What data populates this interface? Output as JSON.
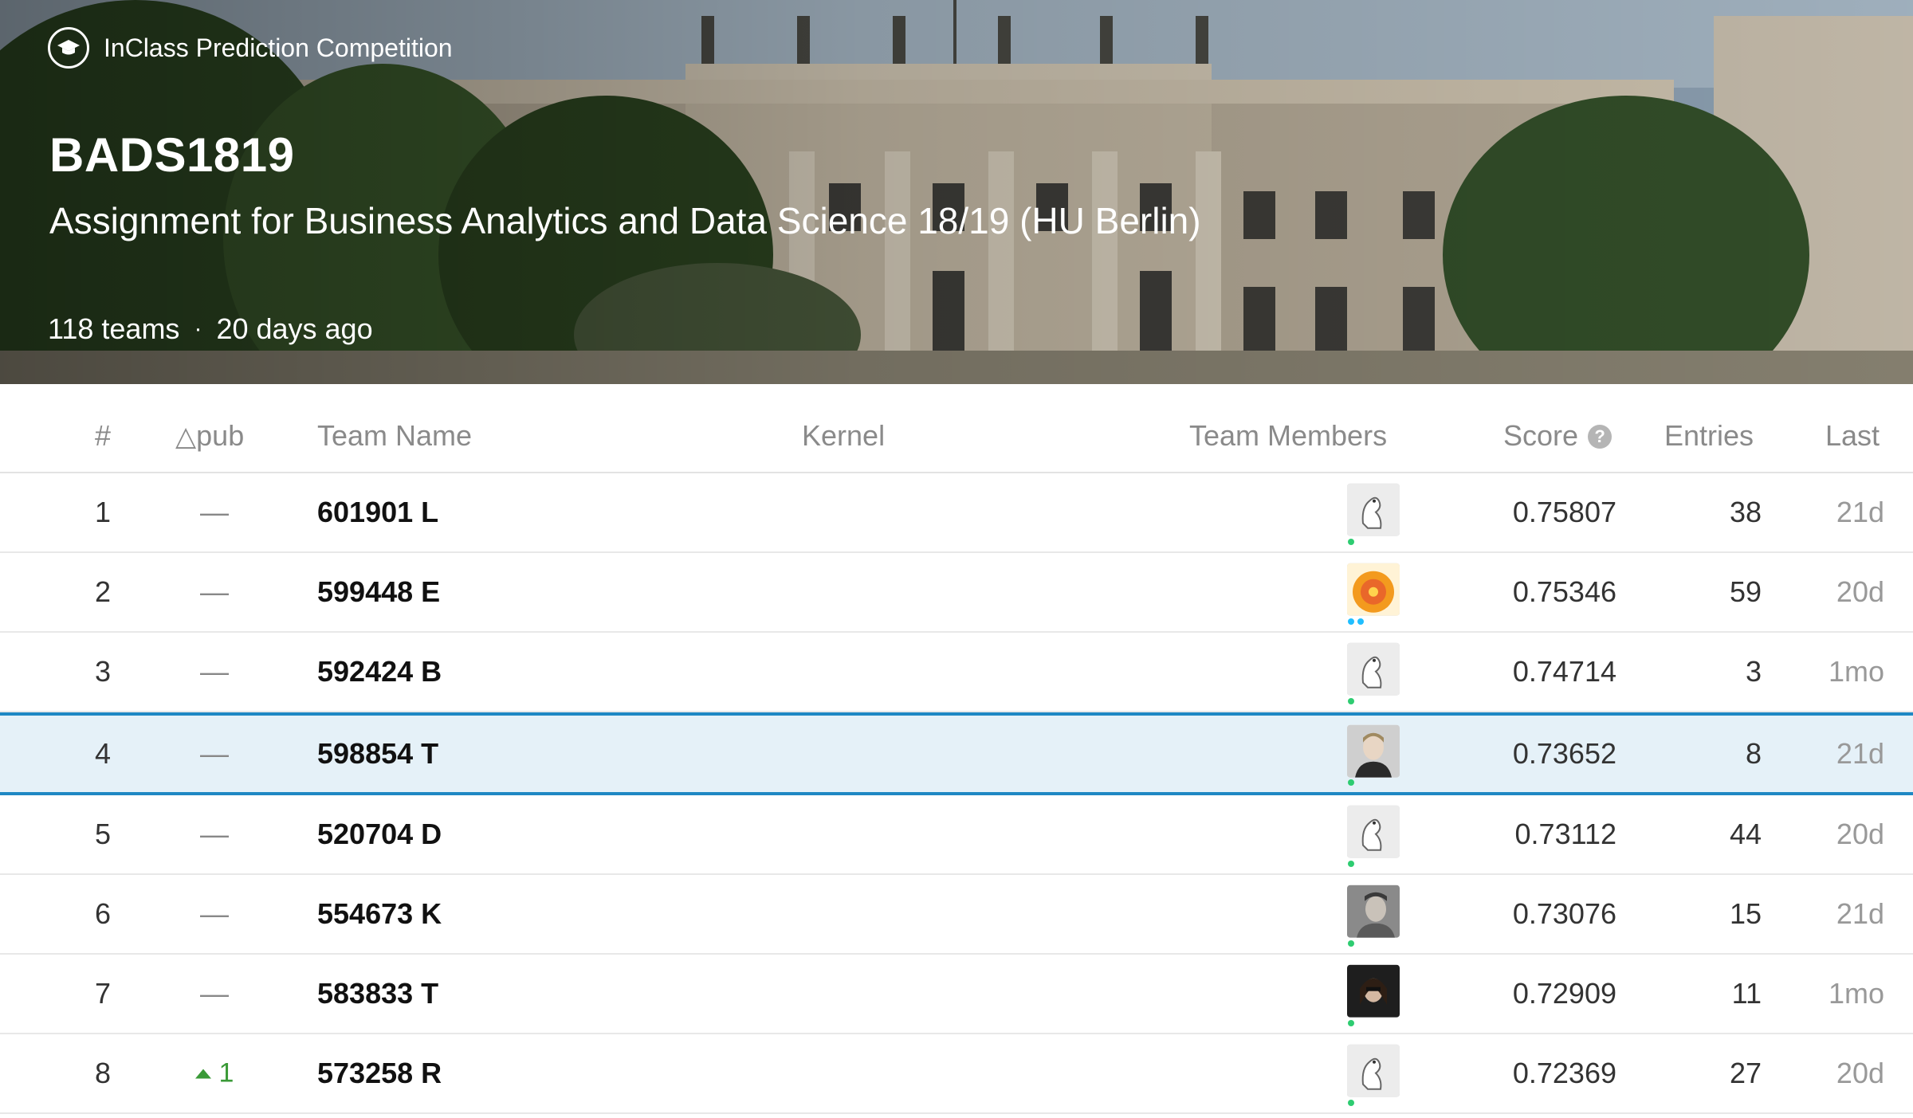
{
  "header": {
    "badge_label": "InClass Prediction Competition",
    "title": "BADS1819",
    "subtitle": "Assignment for Business Analytics and Data Science 18/19 (HU Berlin)",
    "teams": "118 teams",
    "separator": "·",
    "time_ago": "20 days ago",
    "icons": {
      "badge": "graduation-cap-icon"
    }
  },
  "columns": {
    "rank": "#",
    "delta": "pub",
    "delta_symbol": "△",
    "team_name": "Team Name",
    "kernel": "Kernel",
    "team_members": "Team Members",
    "score": "Score",
    "score_help": "?",
    "entries": "Entries",
    "last": "Last"
  },
  "rows": [
    {
      "rank": "1",
      "delta": "—",
      "team": "601901 L",
      "avatar": "kaggle-goose-avatar",
      "score": "0.75807",
      "entries": "38",
      "last": "21d"
    },
    {
      "rank": "2",
      "delta": "—",
      "team": "599448 E",
      "avatar": "orange-flower-avatar",
      "score": "0.75346",
      "entries": "59",
      "last": "20d"
    },
    {
      "rank": "3",
      "delta": "—",
      "team": "592424 B",
      "avatar": "kaggle-goose-avatar",
      "score": "0.74714",
      "entries": "3",
      "last": "1mo"
    },
    {
      "rank": "4",
      "delta": "—",
      "team": "598854 T",
      "avatar": "user-photo-avatar",
      "score": "0.73652",
      "entries": "8",
      "last": "21d"
    },
    {
      "rank": "5",
      "delta": "—",
      "team": "520704 D",
      "avatar": "kaggle-goose-avatar",
      "score": "0.73112",
      "entries": "44",
      "last": "20d"
    },
    {
      "rank": "6",
      "delta": "—",
      "team": "554673 K",
      "avatar": "user-photo-avatar",
      "score": "0.73076",
      "entries": "15",
      "last": "21d"
    },
    {
      "rank": "7",
      "delta": "—",
      "team": "583833 T",
      "avatar": "user-photo-avatar",
      "score": "0.72909",
      "entries": "11",
      "last": "1mo"
    },
    {
      "rank": "8",
      "delta": "1",
      "delta_direction": "up",
      "team": "573258 R",
      "avatar": "kaggle-goose-avatar",
      "score": "0.72369",
      "entries": "27",
      "last": "20d"
    }
  ],
  "colors": {
    "highlight_row": "#e5f1f8",
    "highlight_border": "#1e88c4",
    "rank_up": "#3a9a37",
    "tier_dot": "#20beff"
  }
}
